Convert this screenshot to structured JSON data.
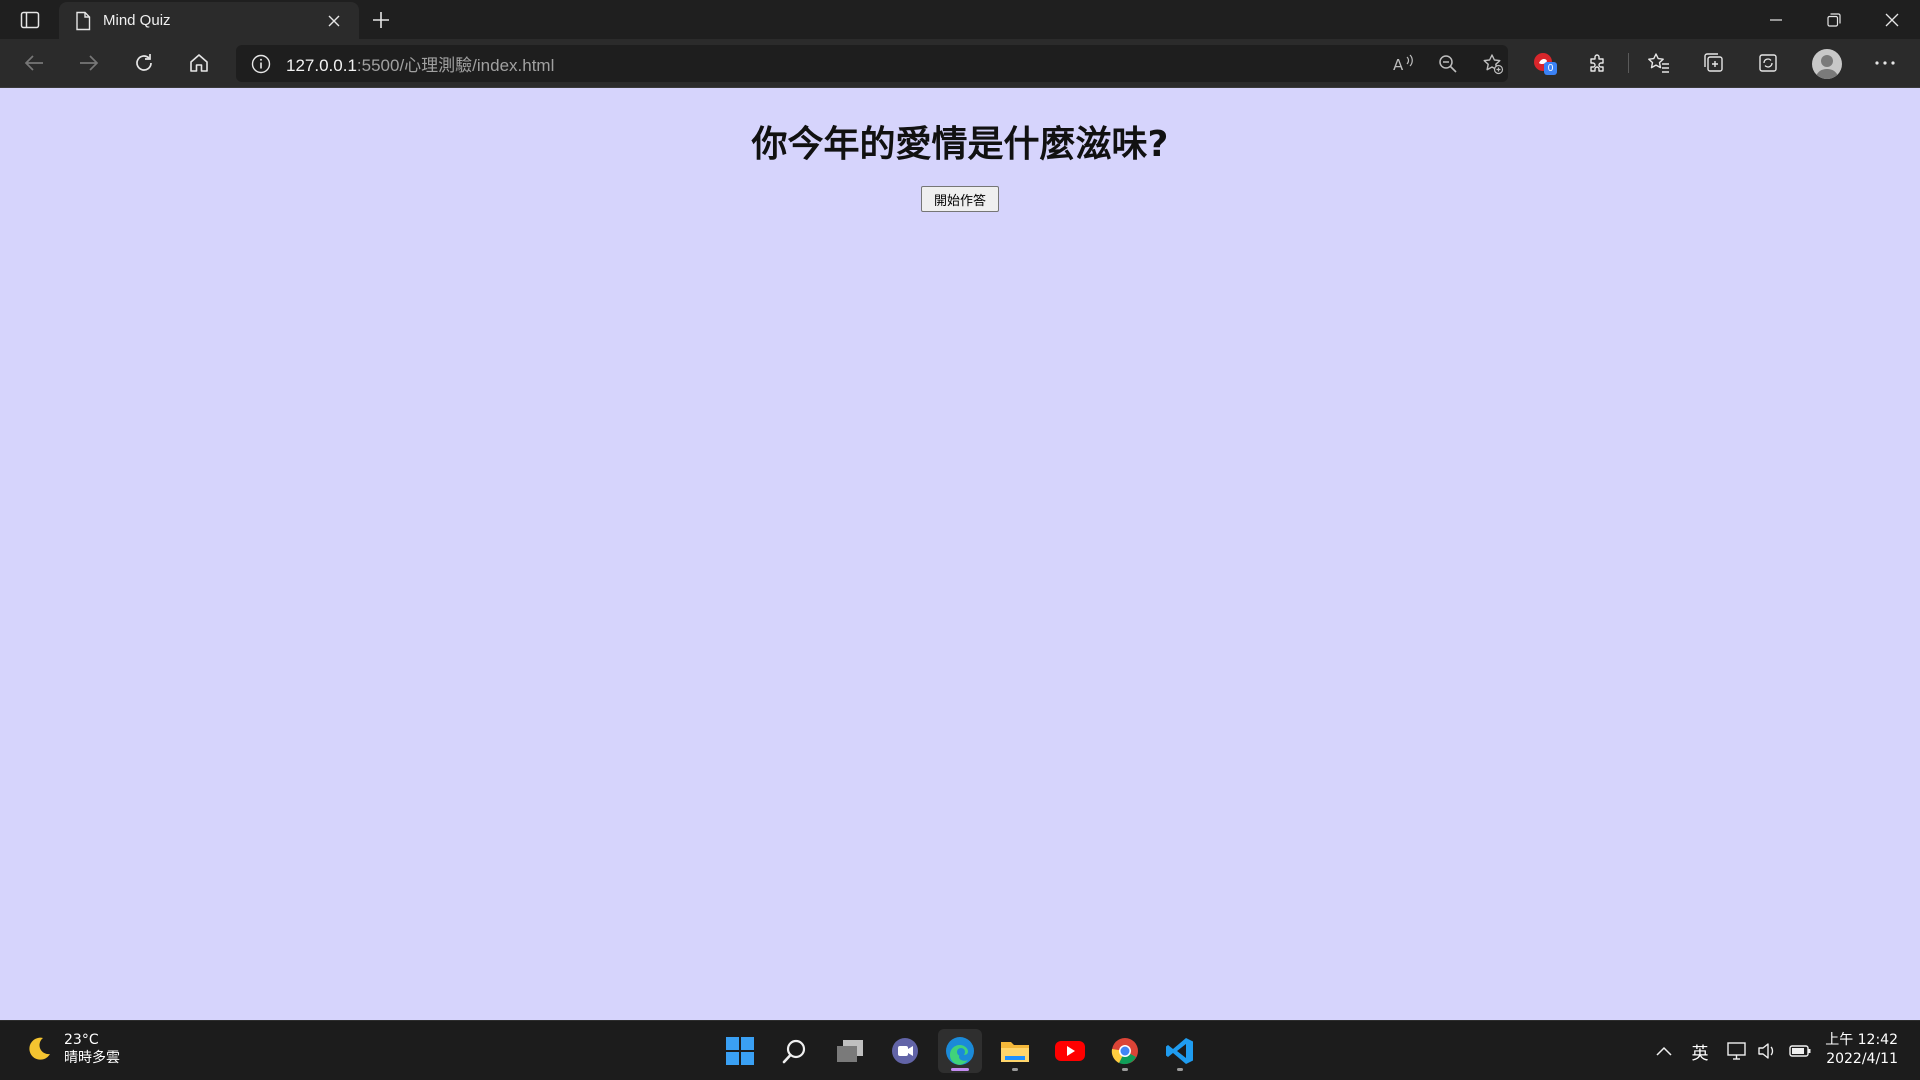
{
  "browser": {
    "tab_title": "Mind Quiz",
    "url_host": "127.0.0.1",
    "url_path": ":5500/心理測驗/index.html",
    "extension_badge": "0"
  },
  "page": {
    "heading": "你今年的愛情是什麼滋味?",
    "start_button": "開始作答",
    "background_color": "#d6d4fc"
  },
  "taskbar": {
    "weather_temp": "23°C",
    "weather_desc": "晴時多雲",
    "ime_label": "英",
    "time": "上午 12:42",
    "date": "2022/4/11",
    "apps": [
      "windows-start",
      "search",
      "task-view",
      "teams-chat",
      "edge",
      "file-explorer",
      "youtube",
      "chrome",
      "vscode"
    ]
  }
}
